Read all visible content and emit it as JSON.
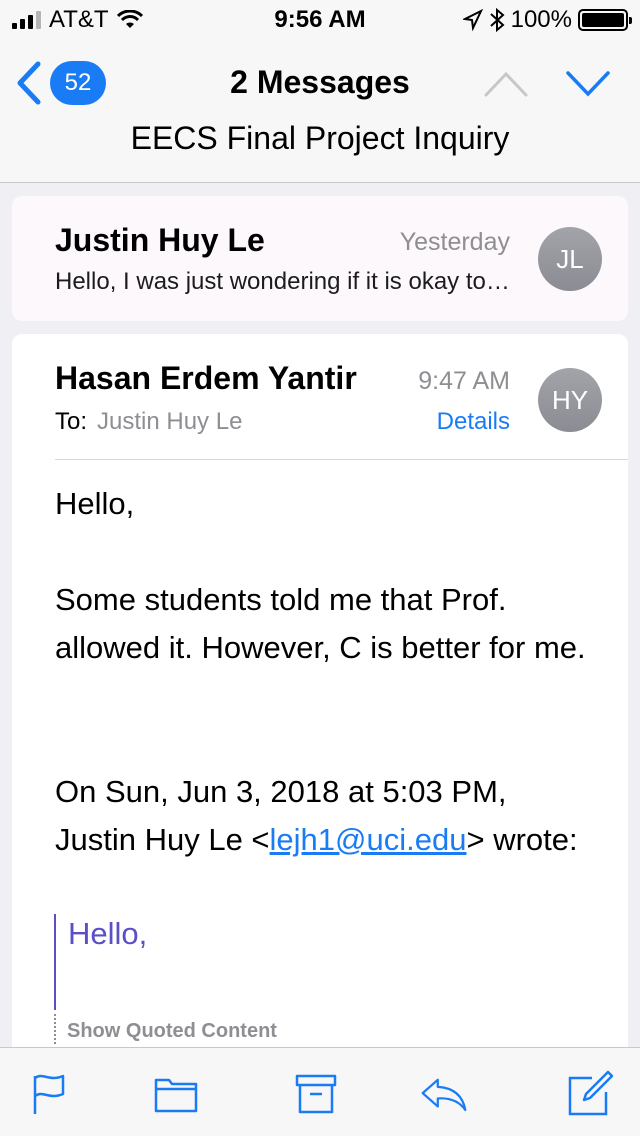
{
  "status_bar": {
    "carrier": "AT&T",
    "time": "9:56 AM",
    "battery": "100%"
  },
  "nav": {
    "back_count": "52",
    "title": "2 Messages",
    "subtitle": "EECS Final Project Inquiry"
  },
  "messages": [
    {
      "sender": "Justin Huy Le",
      "time": "Yesterday",
      "preview": "Hello, I was just wondering if it is okay to use C++ for the final project",
      "avatar_initials": "JL"
    },
    {
      "sender": "Hasan Erdem Yantir",
      "time": "9:47 AM",
      "to_label": "To:",
      "to_name": "Justin Huy Le",
      "details_label": "Details",
      "avatar_initials": "HY",
      "greeting": "Hello,",
      "body": "Some students told me that Prof. allowed it. However, C is better for me.",
      "quote_intro_before": "On Sun, Jun 3, 2018 at 5:03 PM, Justin Huy Le <",
      "quote_email": "lejh1@uci.edu",
      "quote_intro_after": "> wrote:",
      "quoted_text": "Hello,",
      "show_quoted_label": "Show Quoted Content"
    }
  ],
  "colors": {
    "accent": "#1a7cf5",
    "quote": "#5b4fc4",
    "muted": "#8e8e93"
  },
  "toolbar": {
    "icons": [
      "flag-icon",
      "folder-icon",
      "archive-icon",
      "reply-icon",
      "compose-icon"
    ]
  }
}
